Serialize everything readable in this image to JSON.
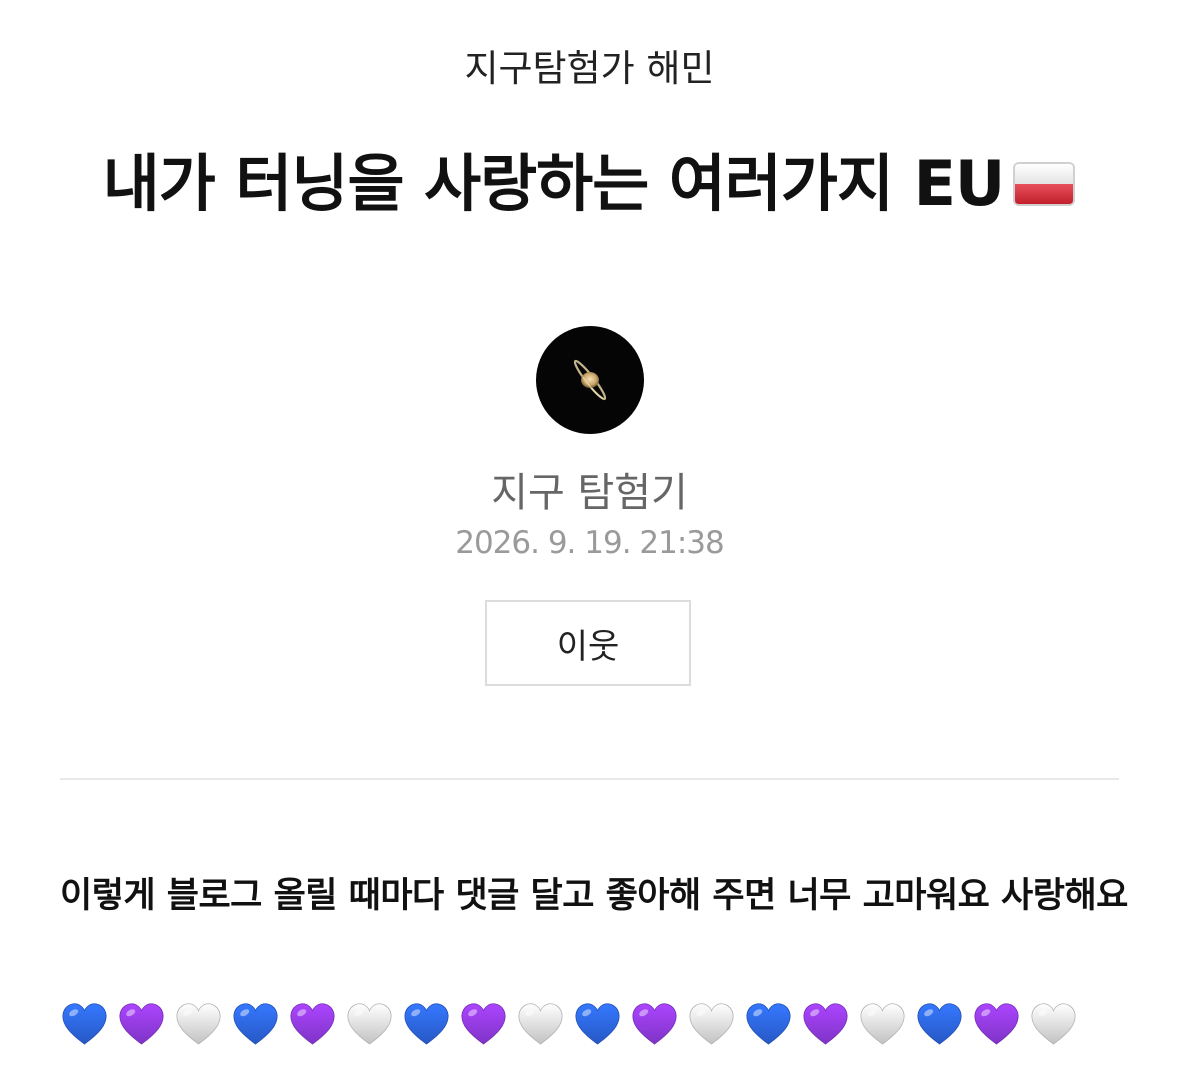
{
  "header": {
    "category": "지구탐험가 해민"
  },
  "post": {
    "title": "내가 터닝을 사랑하는 여러가지 EU",
    "title_emoji": "poland-flag-emoji",
    "author": "지구 탐험기",
    "avatar_icon": "saturn-avatar",
    "date": "2026. 9. 19. 21:38",
    "neighbor_button_label": "이웃",
    "body_text": "이렇게 블로그 올릴 때마다 댓글 달고 좋아해 주면 너무 고마워요 사랑해요",
    "hearts": [
      {
        "icon": "blue-heart-icon",
        "color": "#2f6bf0"
      },
      {
        "icon": "purple-heart-icon",
        "color": "#9a3ef2"
      },
      {
        "icon": "white-heart-icon",
        "color": "#ececec"
      },
      {
        "icon": "blue-heart-icon",
        "color": "#2f6bf0"
      },
      {
        "icon": "purple-heart-icon",
        "color": "#9a3ef2"
      },
      {
        "icon": "white-heart-icon",
        "color": "#ececec"
      },
      {
        "icon": "blue-heart-icon",
        "color": "#2f6bf0"
      },
      {
        "icon": "purple-heart-icon",
        "color": "#9a3ef2"
      },
      {
        "icon": "white-heart-icon",
        "color": "#ececec"
      },
      {
        "icon": "blue-heart-icon",
        "color": "#2f6bf0"
      },
      {
        "icon": "purple-heart-icon",
        "color": "#9a3ef2"
      },
      {
        "icon": "white-heart-icon",
        "color": "#ececec"
      },
      {
        "icon": "blue-heart-icon",
        "color": "#2f6bf0"
      },
      {
        "icon": "purple-heart-icon",
        "color": "#9a3ef2"
      },
      {
        "icon": "white-heart-icon",
        "color": "#ececec"
      },
      {
        "icon": "blue-heart-icon",
        "color": "#2f6bf0"
      },
      {
        "icon": "purple-heart-icon",
        "color": "#9a3ef2"
      },
      {
        "icon": "white-heart-icon",
        "color": "#ececec"
      }
    ]
  }
}
